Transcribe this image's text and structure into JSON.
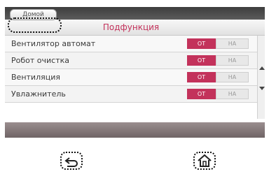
{
  "header": {
    "home_label": "Домой",
    "title": "Подфункция"
  },
  "rows": [
    {
      "label": "Вентилятор автомат",
      "off_label": "ОТ",
      "on_label": "НА"
    },
    {
      "label": "Робот очистка",
      "off_label": "ОТ",
      "on_label": "НА"
    },
    {
      "label": "Вентиляция",
      "off_label": "ОТ",
      "on_label": "НА"
    },
    {
      "label": "Увлажнитель",
      "off_label": "ОТ",
      "on_label": "НА"
    }
  ],
  "colors": {
    "accent": "#c3325b",
    "top_bar": "#3d3d3d"
  },
  "hardware_buttons": {
    "back_icon": "back-arrow-icon",
    "home_icon": "home-icon"
  }
}
